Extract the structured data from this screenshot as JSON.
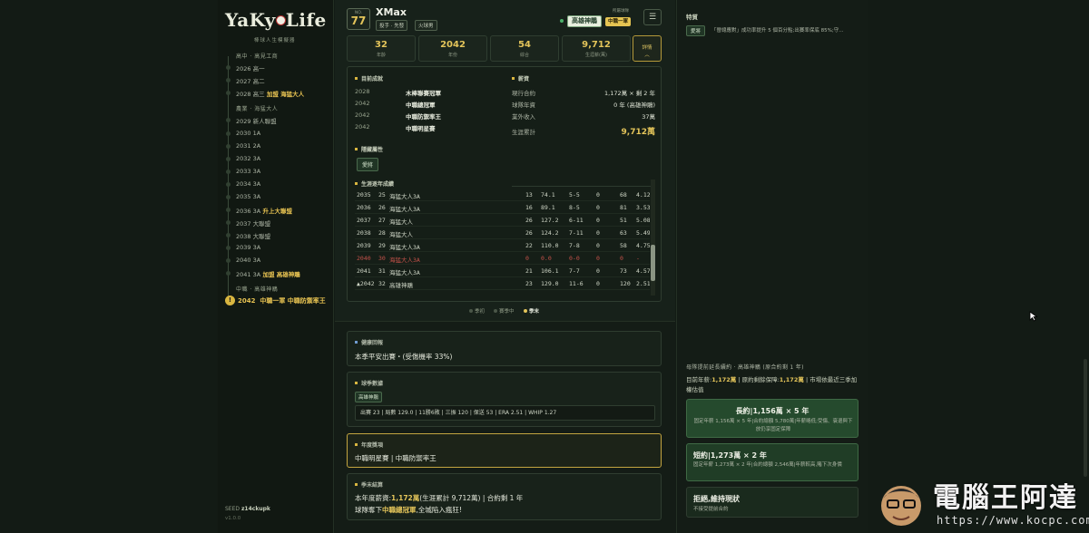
{
  "app": {
    "logo": "YaKy●Life",
    "logo_sub": "棒球人生模擬器"
  },
  "timeline": {
    "sections": [
      {
        "label": "高中 · 高見工商"
      },
      {
        "label": "農業 · 海猛大人"
      },
      {
        "label": "中職 · 高雄神鵰"
      }
    ],
    "rows": [
      {
        "year": "2026",
        "text": "高一",
        "hl": ""
      },
      {
        "year": "2027",
        "text": "高二",
        "hl": ""
      },
      {
        "year": "2028",
        "text": "高三",
        "hl": "加盟 海猛大人"
      },
      {
        "year": "2029",
        "text": "新人聯盟",
        "hl": ""
      },
      {
        "year": "2030",
        "text": "1A",
        "hl": ""
      },
      {
        "year": "2031",
        "text": "2A",
        "hl": ""
      },
      {
        "year": "2032",
        "text": "3A",
        "hl": ""
      },
      {
        "year": "2033",
        "text": "3A",
        "hl": ""
      },
      {
        "year": "2034",
        "text": "3A",
        "hl": ""
      },
      {
        "year": "2035",
        "text": "3A",
        "hl": ""
      },
      {
        "year": "2036",
        "text": "3A",
        "hl": "升上大聯盟"
      },
      {
        "year": "2037",
        "text": "大聯盟",
        "hl": ""
      },
      {
        "year": "2038",
        "text": "大聯盟",
        "hl": ""
      },
      {
        "year": "2039",
        "text": "3A",
        "hl": ""
      },
      {
        "year": "2040",
        "text": "3A",
        "hl": ""
      },
      {
        "year": "2041",
        "text": "3A",
        "hl": "加盟 高雄神鵰"
      }
    ],
    "current": {
      "year": "2042",
      "text": "中職一軍 中職防禦率王",
      "badge": "!"
    }
  },
  "seed": {
    "label": "SEED",
    "value": "z14ckupk",
    "version": "v1.0.0"
  },
  "player": {
    "number_label": "NO.",
    "number": "77",
    "name": "XMax",
    "tags": [
      "投手 · 先發",
      "火球男"
    ],
    "team_label": "所屬球隊",
    "team": "高雄神鵰",
    "league": "中職一軍",
    "menu_icon": "☰"
  },
  "stats": [
    {
      "value": "32",
      "label": "年齡"
    },
    {
      "value": "2042",
      "label": "年份"
    },
    {
      "value": "54",
      "label": "綜合"
    },
    {
      "value": "9,712",
      "label": "生涯薪(萬)"
    }
  ],
  "detail_btn": {
    "label": "詳情",
    "icon": "︿"
  },
  "honors": {
    "title": "目前成就",
    "items": [
      {
        "year": "2028",
        "text": "木棒聯賽冠軍"
      },
      {
        "year": "2042",
        "text": "中職總冠軍"
      },
      {
        "year": "2042",
        "text": "中職防禦率王"
      },
      {
        "year": "2042",
        "text": "中職明星賽"
      }
    ]
  },
  "salary": {
    "title": "薪資",
    "rows": [
      {
        "label": "現行合約",
        "value": "1,172萬 × 剩 2 年"
      },
      {
        "label": "球隊年資",
        "value": "0 年 (高雄神鵰)"
      },
      {
        "label": "業外收入",
        "value": "37萬"
      }
    ],
    "total_label": "生涯累計",
    "total_value": "9,712萬"
  },
  "attributes": {
    "title": "隱藏屬性",
    "items": [
      "愛將"
    ]
  },
  "career": {
    "title": "生涯逐年成績",
    "rows": [
      {
        "y": "2035",
        "a": "25",
        "team": "海猛大人3A",
        "g": "13",
        "ip": "74.1",
        "wl": "5-5",
        "sv": "0",
        "so": "68",
        "era": "4.12",
        "red": false
      },
      {
        "y": "2036",
        "a": "26",
        "team": "海猛大人3A",
        "g": "16",
        "ip": "89.1",
        "wl": "8-5",
        "sv": "0",
        "so": "81",
        "era": "3.53",
        "red": false
      },
      {
        "y": "2037",
        "a": "27",
        "team": "海猛大人",
        "g": "26",
        "ip": "127.2",
        "wl": "6-11",
        "sv": "0",
        "so": "51",
        "era": "5.08",
        "red": false
      },
      {
        "y": "2038",
        "a": "28",
        "team": "海猛大人",
        "g": "26",
        "ip": "124.2",
        "wl": "7-11",
        "sv": "0",
        "so": "63",
        "era": "5.49",
        "red": false
      },
      {
        "y": "2039",
        "a": "29",
        "team": "海猛大人3A",
        "g": "22",
        "ip": "110.0",
        "wl": "7-8",
        "sv": "0",
        "so": "58",
        "era": "4.75",
        "red": false
      },
      {
        "y": "2040",
        "a": "30",
        "team": "海猛大人3A",
        "g": "0",
        "ip": "0.0",
        "wl": "0-0",
        "sv": "0",
        "so": "0",
        "era": "-",
        "red": true
      },
      {
        "y": "2041",
        "a": "31",
        "team": "海猛大人3A",
        "g": "21",
        "ip": "106.1",
        "wl": "7-7",
        "sv": "0",
        "so": "73",
        "era": "4.57",
        "red": false
      },
      {
        "y": "▲2042",
        "a": "32",
        "team": "高雄神鵰",
        "g": "23",
        "ip": "129.0",
        "wl": "11-6",
        "sv": "0",
        "so": "120",
        "era": "2.51",
        "red": false
      }
    ]
  },
  "phase_legend": [
    {
      "label": "季初",
      "active": false
    },
    {
      "label": "賽季中",
      "active": false
    },
    {
      "label": "季末",
      "active": true
    }
  ],
  "health": {
    "title": "健康回報",
    "text": "本季平安出賽・(受傷機率 33%)"
  },
  "season_stats": {
    "title": "球季數據",
    "chip": "高雄神鵰",
    "line": "出賽 23 | 局數 129.0 | 11勝6敗 | 三振 120 | 保送 53 | ERA 2.51 | WHIP 1.27"
  },
  "awards": {
    "title": "年度獎項",
    "text": "中職明星賽 | 中職防禦率王"
  },
  "season_end": {
    "title": "季末結算",
    "line1_pre": "本年度薪資:",
    "line1_hl": "1,172萬",
    "line1_post": "(生涯累計 9,712萬) | 合約剩 1 年",
    "line2_pre": "球隊奪下",
    "line2_hl": "中職總冠軍",
    "line2_post": ",全城陷入瘋狂!"
  },
  "traits": {
    "title": "特質",
    "chip": "愛將",
    "desc": "「晉總應對」成功率提升 5 個百分點;出賽率保底 85%;守…"
  },
  "offer": {
    "head": "母隊提前延長續約 · 高雄神鵰 (原合約剩 1 年)",
    "sub_pre": "目前年薪:",
    "sub_hl1": "1,172萬",
    "sub_mid": "| 原約剩餘保障:",
    "sub_hl2": "1,172萬",
    "sub_post": "| 市場依最近三季加權估值",
    "options": [
      {
        "title": "長約|1,156萬 × 5 年",
        "desc": "固定年薪 1,156萬 × 5 年|合約總額 5,780萬|年薪略低;受傷、衰退與下放仍享固定保障"
      },
      {
        "title": "短約|1,273萬 × 2 年",
        "desc": "固定年薪 1,273萬 × 2 年|合約總額 2,546萬|年薪較高,賭下次身價"
      },
      {
        "title": "拒絕,維持現狀",
        "desc": "不接受提前合約"
      }
    ]
  },
  "watermark": {
    "text": "電腦王阿達",
    "url": "https://www.kocpc.com.tw"
  }
}
